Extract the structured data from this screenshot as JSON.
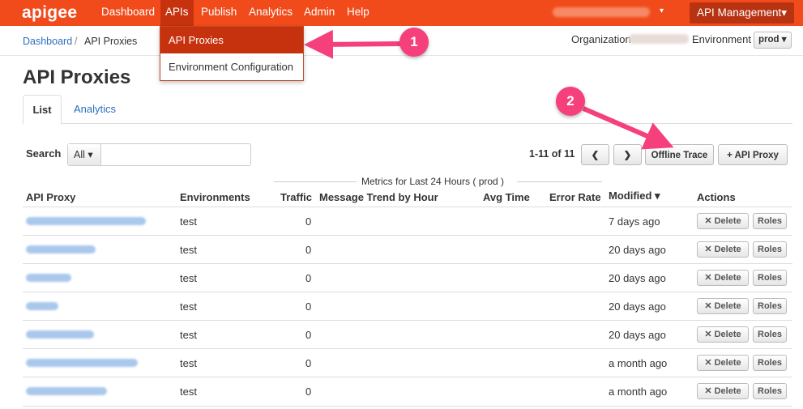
{
  "brand": "apigee",
  "nav": {
    "items": [
      "Dashboard",
      "APIs",
      "Publish",
      "Analytics",
      "Admin",
      "Help"
    ],
    "user_caret": "▾",
    "management_label": "API Management▾"
  },
  "apis_menu": {
    "items": [
      "API Proxies",
      "Environment Configuration"
    ]
  },
  "breadcrumb": {
    "home": "Dashboard",
    "separator": "/",
    "current": "API Proxies"
  },
  "org_bar": {
    "organization_label": "Organization",
    "environment_label": "Environment",
    "environment_value": "prod ▾"
  },
  "callouts": [
    "1",
    "2"
  ],
  "page": {
    "title": "API Proxies",
    "tabs": [
      "List",
      "Analytics"
    ]
  },
  "search": {
    "label": "Search",
    "scope": "All ▾",
    "value": ""
  },
  "pager": {
    "count": "1-11 of 11",
    "prev": "❮",
    "next": "❯"
  },
  "toolbar": {
    "offline_trace": "Offline Trace",
    "add_proxy": "+ API Proxy"
  },
  "table": {
    "metrics_caption": "Metrics for Last 24 Hours (   prod   )",
    "headers": {
      "proxy": "API Proxy",
      "environments": "Environments",
      "traffic": "Traffic",
      "trend": "Message Trend by Hour",
      "avg_time": "Avg Time",
      "error_rate": "Error Rate",
      "modified": "Modified ▾",
      "actions": "Actions"
    },
    "delete_label": "✕ Delete",
    "roles_label": "Roles",
    "rows": [
      {
        "environment": "test",
        "traffic": "0",
        "modified": "7 days ago"
      },
      {
        "environment": "test",
        "traffic": "0",
        "modified": "20 days ago"
      },
      {
        "environment": "test",
        "traffic": "0",
        "modified": "20 days ago"
      },
      {
        "environment": "test",
        "traffic": "0",
        "modified": "20 days ago"
      },
      {
        "environment": "test",
        "traffic": "0",
        "modified": "20 days ago"
      },
      {
        "environment": "test",
        "traffic": "0",
        "modified": "a month ago"
      },
      {
        "environment": "test",
        "traffic": "0",
        "modified": "a month ago"
      }
    ]
  },
  "colors": {
    "brand_orange": "#f24b1b",
    "active_nav": "#c7320e",
    "link_blue": "#2a6fbf",
    "callout_pink": "#f5407c"
  }
}
